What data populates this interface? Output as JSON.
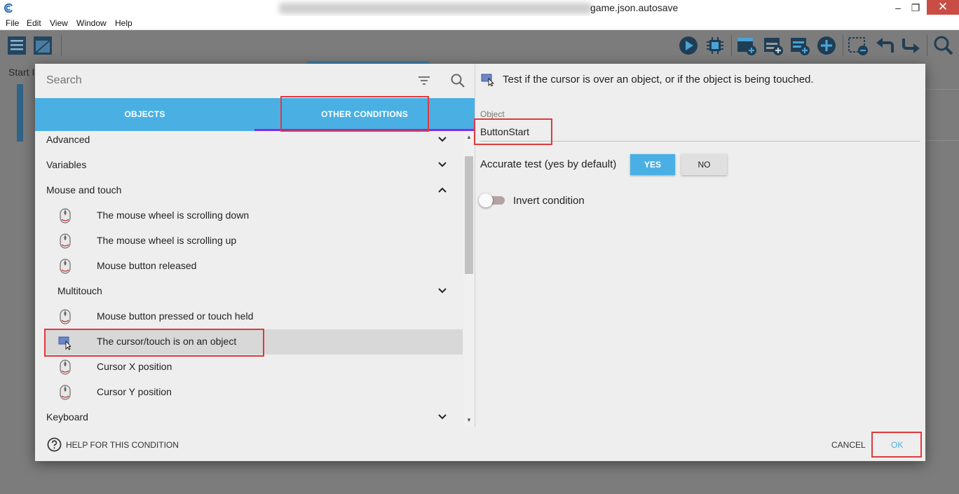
{
  "window": {
    "title_suffix": "game.json.autosave",
    "minimize": "–",
    "maximize": "❐",
    "close": "✕"
  },
  "menu": [
    "File",
    "Edit",
    "View",
    "Window",
    "Help"
  ],
  "background": {
    "start_label": "Start I"
  },
  "dialog": {
    "search_placeholder": "Search",
    "tabs": {
      "objects": "OBJECTS",
      "other_conditions": "OTHER CONDITIONS"
    },
    "list": [
      {
        "label": "Advanced",
        "kind": "category",
        "chevron": "down"
      },
      {
        "label": "Variables",
        "kind": "category",
        "chevron": "down"
      },
      {
        "label": "Mouse and touch",
        "kind": "category",
        "chevron": "up"
      },
      {
        "label": "The mouse wheel is scrolling down",
        "kind": "item",
        "icon": "mouse-icon"
      },
      {
        "label": "The mouse wheel is scrolling up",
        "kind": "item",
        "icon": "mouse-icon"
      },
      {
        "label": "Mouse button released",
        "kind": "item",
        "icon": "mouse-icon"
      },
      {
        "label": "Multitouch",
        "kind": "subcategory",
        "chevron": "down"
      },
      {
        "label": "Mouse button pressed or touch held",
        "kind": "item",
        "icon": "mouse-icon"
      },
      {
        "label": "The cursor/touch is on an object",
        "kind": "item",
        "icon": "cursor-object-icon",
        "selected": true
      },
      {
        "label": "Cursor X position",
        "kind": "item",
        "icon": "mouse-icon"
      },
      {
        "label": "Cursor Y position",
        "kind": "item",
        "icon": "mouse-icon"
      },
      {
        "label": "Keyboard",
        "kind": "category",
        "chevron": "down"
      }
    ],
    "description": "Test if the cursor is over an object, or if the object is being touched.",
    "object_field": {
      "label": "Object",
      "value": "ButtonStart"
    },
    "accurate": {
      "label": "Accurate test (yes by default)",
      "yes": "YES",
      "no": "NO",
      "selected": "YES"
    },
    "invert": {
      "label": "Invert condition",
      "on": false
    },
    "footer": {
      "help": "HELP FOR THIS CONDITION",
      "cancel": "CANCEL",
      "ok": "OK"
    }
  },
  "colors": {
    "accent": "#4ab0e4",
    "tab_indicator": "#8a2be2",
    "annotation": "#e0393e"
  }
}
